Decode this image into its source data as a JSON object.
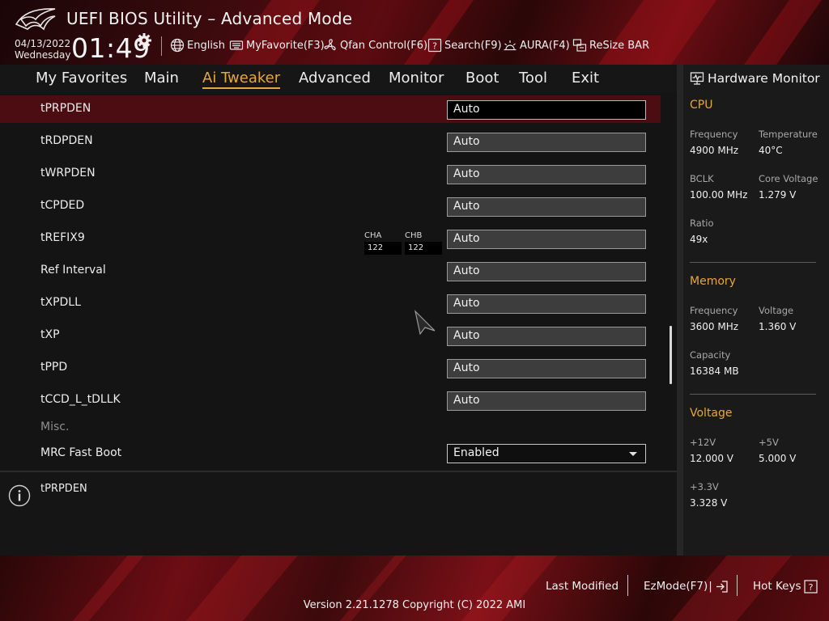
{
  "header": {
    "title": "UEFI BIOS Utility – Advanced Mode",
    "date": "04/13/2022",
    "weekday": "Wednesday",
    "time": "01:49",
    "toolbar": [
      {
        "id": "language",
        "icon": "globe-icon",
        "label": "English"
      },
      {
        "id": "myfavorite",
        "icon": "keyboard-icon",
        "label": "MyFavorite(F3)"
      },
      {
        "id": "qfan",
        "icon": "fan-icon",
        "label": "Qfan Control(F6)"
      },
      {
        "id": "search",
        "icon": "question-box-icon",
        "label": "Search(F9)"
      },
      {
        "id": "aura",
        "icon": "aura-icon",
        "label": "AURA(F4)"
      },
      {
        "id": "resizebar",
        "icon": "resize-bar-icon",
        "label": "ReSize BAR"
      }
    ]
  },
  "menu": {
    "tabs": [
      {
        "label": "My Favorites",
        "active": false
      },
      {
        "label": "Main",
        "active": false
      },
      {
        "label": "Ai Tweaker",
        "active": true
      },
      {
        "label": "Advanced",
        "active": false
      },
      {
        "label": "Monitor",
        "active": false
      },
      {
        "label": "Boot",
        "active": false
      },
      {
        "label": "Tool",
        "active": false
      },
      {
        "label": "Exit",
        "active": false
      }
    ]
  },
  "settings": {
    "rows": [
      {
        "label": "tPRPDEN",
        "value": "Auto",
        "selected": true
      },
      {
        "label": "tRDPDEN",
        "value": "Auto"
      },
      {
        "label": "tWRPDEN",
        "value": "Auto"
      },
      {
        "label": "tCPDED",
        "value": "Auto"
      },
      {
        "label": "tREFIX9",
        "value": "Auto"
      },
      {
        "label": "Ref Interval",
        "value": "Auto"
      },
      {
        "label": "tXPDLL",
        "value": "Auto"
      },
      {
        "label": "tXP",
        "value": "Auto"
      },
      {
        "label": "tPPD",
        "value": "Auto"
      },
      {
        "label": "tCCD_L_tDLLK",
        "value": "Auto"
      }
    ],
    "channels": [
      {
        "name": "CHA",
        "value": "122"
      },
      {
        "name": "CHB",
        "value": "122"
      }
    ],
    "misc_label": "Misc.",
    "mrc": {
      "label": "MRC Fast Boot",
      "value": "Enabled"
    }
  },
  "help": {
    "text": "tPRPDEN"
  },
  "hardware_monitor": {
    "title": "Hardware Monitor",
    "cpu": {
      "section": "CPU",
      "frequency_label": "Frequency",
      "frequency": "4900 MHz",
      "temperature_label": "Temperature",
      "temperature": "40°C",
      "bclk_label": "BCLK",
      "bclk": "100.00 MHz",
      "core_voltage_label": "Core Voltage",
      "core_voltage": "1.279 V",
      "ratio_label": "Ratio",
      "ratio": "49x"
    },
    "memory": {
      "section": "Memory",
      "frequency_label": "Frequency",
      "frequency": "3600 MHz",
      "voltage_label": "Voltage",
      "voltage": "1.360 V",
      "capacity_label": "Capacity",
      "capacity": "16384 MB"
    },
    "voltage": {
      "section": "Voltage",
      "v12_label": "+12V",
      "v12": "12.000 V",
      "v5_label": "+5V",
      "v5": "5.000 V",
      "v33_label": "+3.3V",
      "v33": "3.328 V"
    }
  },
  "footer": {
    "last_modified": "Last Modified",
    "ezmode": "EzMode(F7)",
    "hotkeys": "Hot Keys",
    "version": "Version 2.21.1278 Copyright (C) 2022 AMI"
  },
  "colors": {
    "accent": "#e8a73a",
    "selected_row": "#4b0d11",
    "brand_red": "#6b0d13"
  }
}
